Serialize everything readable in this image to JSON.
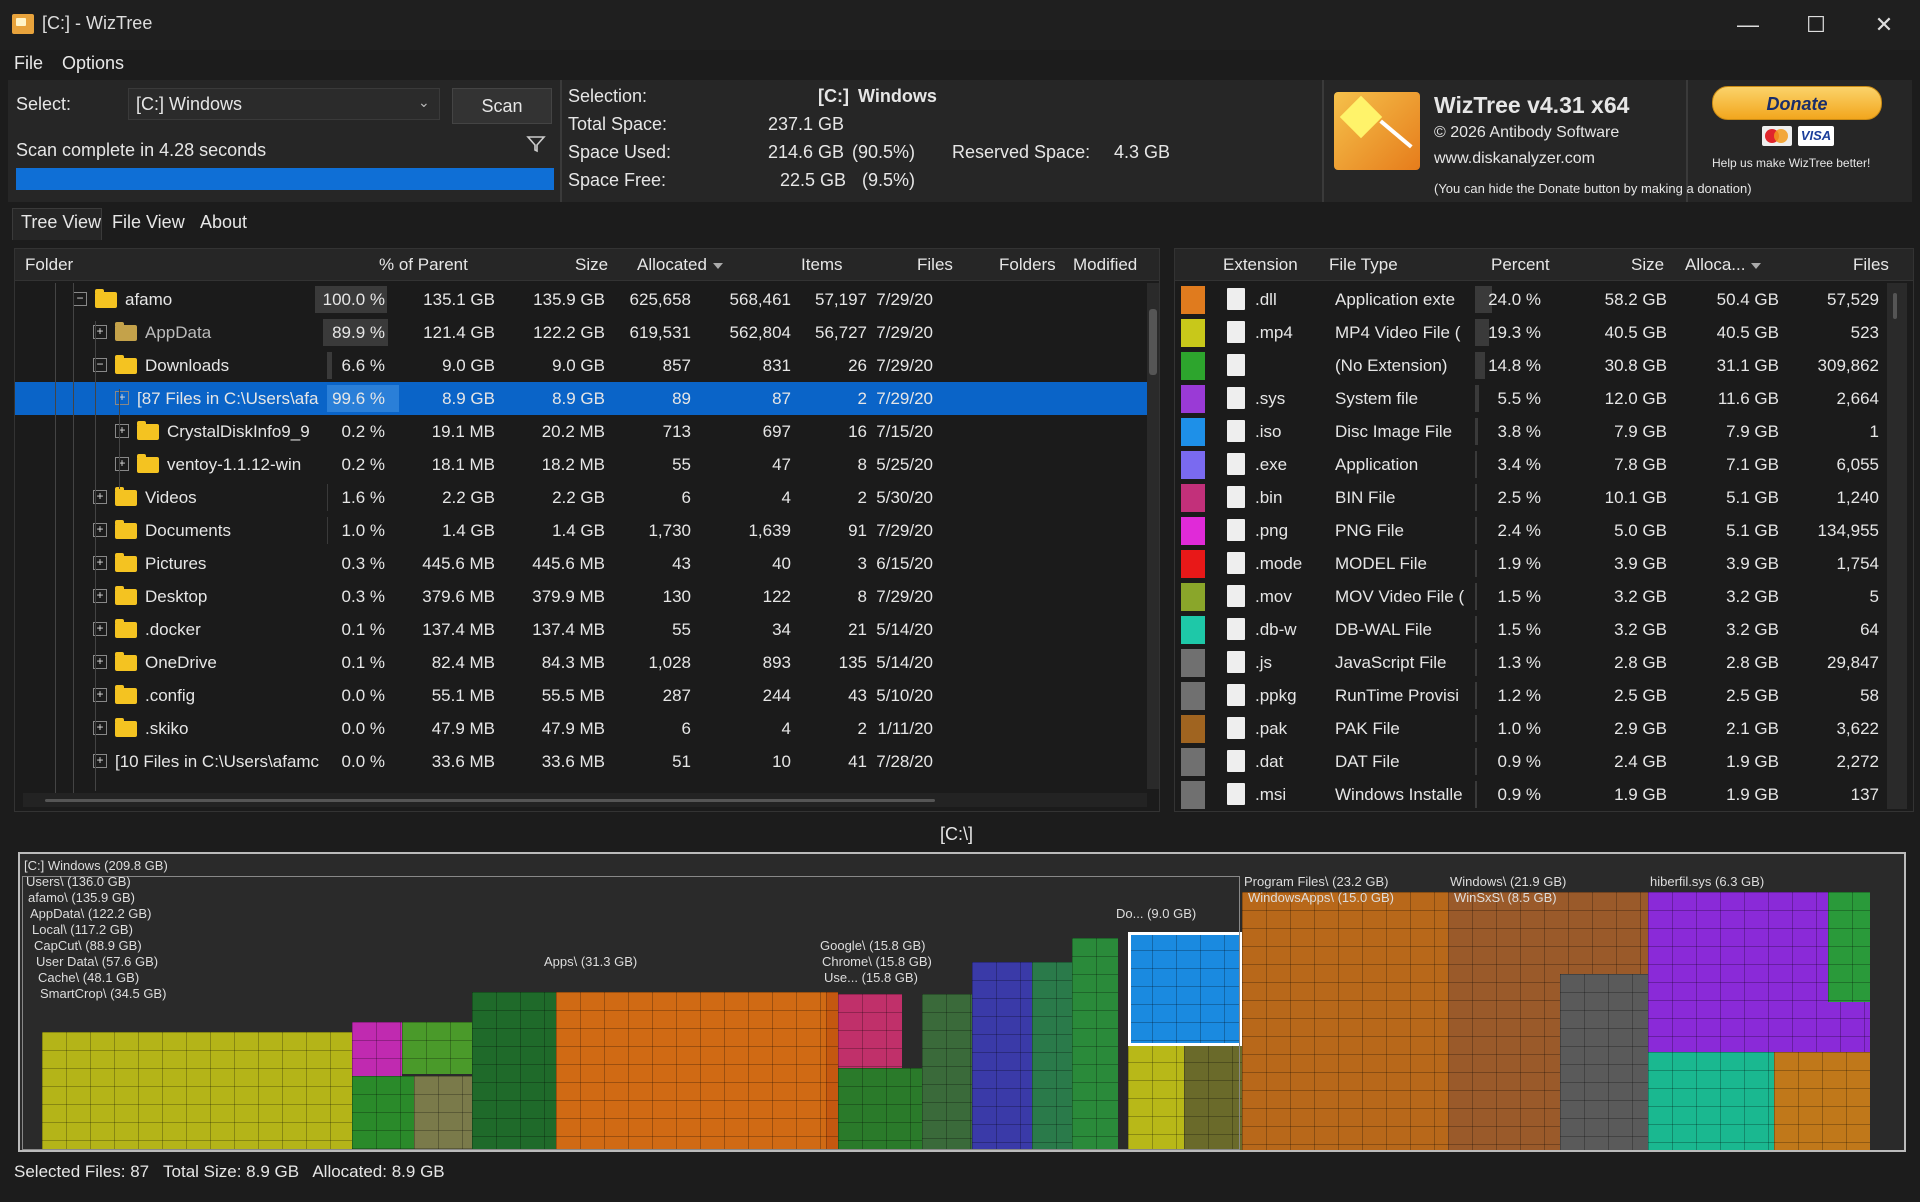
{
  "window": {
    "title": "[C:]  - WizTree",
    "controls": {
      "minimize": "—",
      "maximize": "☐",
      "close": "✕"
    }
  },
  "menu": [
    "File",
    "Options"
  ],
  "top": {
    "select_label": "Select:",
    "select_value": "[C:] Windows",
    "scan_label": "Scan",
    "status": "Scan complete in 4.28 seconds",
    "progress": 1.0,
    "selection_label": "Selection:",
    "selection_drive": "[C:]",
    "selection_name": "Windows",
    "total_space_label": "Total Space:",
    "total_space": "237.1 GB",
    "space_used_label": "Space Used:",
    "space_used": "214.6 GB",
    "space_used_pct": "(90.5%)",
    "space_free_label": "Space Free:",
    "space_free": "22.5 GB",
    "space_free_pct": "(9.5%)",
    "reserved_label": "Reserved Space:",
    "reserved": "4.3 GB"
  },
  "about": {
    "product": "WizTree v4.31 x64",
    "copyright": "© 2026 Antibody Software",
    "website": "www.diskanalyzer.com",
    "hide_note": "(You can hide the Donate button by making a donation)",
    "donate": "Donate",
    "visa": "VISA",
    "help_text": "Help us make WizTree better!"
  },
  "tabs": [
    "Tree View",
    "File View",
    "About"
  ],
  "tree": {
    "headers": {
      "folder": "Folder",
      "pct": "% of Parent",
      "size": "Size",
      "allocated": "Allocated",
      "items": "Items",
      "files": "Files",
      "folders": "Folders",
      "modified": "Modified"
    },
    "rows": [
      {
        "name": "afamo",
        "pct": "100.0 %",
        "pct_fill": 1.0,
        "size": "135.1 GB",
        "allocated": "135.9 GB",
        "items": "625,658",
        "files": "568,461",
        "folders": "57,197",
        "modified": "7/29/20",
        "toggle": "−"
      },
      {
        "name": "AppData",
        "pct": "89.9 %",
        "pct_fill": 0.899,
        "size": "121.4 GB",
        "allocated": "122.2 GB",
        "items": "619,531",
        "files": "562,804",
        "folders": "56,727",
        "modified": "7/29/20",
        "toggle": "+"
      },
      {
        "name": "Downloads",
        "pct": "6.6 %",
        "pct_fill": 0.066,
        "size": "9.0 GB",
        "allocated": "9.0 GB",
        "items": "857",
        "files": "831",
        "folders": "26",
        "modified": "7/29/20",
        "toggle": "−"
      },
      {
        "name": "[87 Files in C:\\Users\\afa",
        "pct": "99.6 %",
        "pct_fill": 0.996,
        "size": "8.9 GB",
        "allocated": "8.9 GB",
        "items": "89",
        "files": "87",
        "folders": "2",
        "modified": "7/29/20",
        "toggle": "+"
      },
      {
        "name": "CrystalDiskInfo9_9",
        "pct": "0.2 %",
        "pct_fill": 0.002,
        "size": "19.1 MB",
        "allocated": "20.2 MB",
        "items": "713",
        "files": "697",
        "folders": "16",
        "modified": "7/15/20",
        "toggle": "+"
      },
      {
        "name": "ventoy-1.1.12-win",
        "pct": "0.2 %",
        "pct_fill": 0.002,
        "size": "18.1 MB",
        "allocated": "18.2 MB",
        "items": "55",
        "files": "47",
        "folders": "8",
        "modified": "5/25/20",
        "toggle": "+"
      },
      {
        "name": "Videos",
        "pct": "1.6 %",
        "pct_fill": 0.016,
        "size": "2.2 GB",
        "allocated": "2.2 GB",
        "items": "6",
        "files": "4",
        "folders": "2",
        "modified": "5/30/20",
        "toggle": "+"
      },
      {
        "name": "Documents",
        "pct": "1.0 %",
        "pct_fill": 0.01,
        "size": "1.4 GB",
        "allocated": "1.4 GB",
        "items": "1,730",
        "files": "1,639",
        "folders": "91",
        "modified": "7/29/20",
        "toggle": "+"
      },
      {
        "name": "Pictures",
        "pct": "0.3 %",
        "pct_fill": 0.003,
        "size": "445.6 MB",
        "allocated": "445.6 MB",
        "items": "43",
        "files": "40",
        "folders": "3",
        "modified": "6/15/20",
        "toggle": "+"
      },
      {
        "name": "Desktop",
        "pct": "0.3 %",
        "pct_fill": 0.003,
        "size": "379.6 MB",
        "allocated": "379.9 MB",
        "items": "130",
        "files": "122",
        "folders": "8",
        "modified": "7/29/20",
        "toggle": "+"
      },
      {
        "name": ".docker",
        "pct": "0.1 %",
        "pct_fill": 0.001,
        "size": "137.4 MB",
        "allocated": "137.4 MB",
        "items": "55",
        "files": "34",
        "folders": "21",
        "modified": "5/14/20",
        "toggle": "+"
      },
      {
        "name": "OneDrive",
        "pct": "0.1 %",
        "pct_fill": 0.001,
        "size": "82.4 MB",
        "allocated": "84.3 MB",
        "items": "1,028",
        "files": "893",
        "folders": "135",
        "modified": "5/14/20",
        "toggle": "+"
      },
      {
        "name": ".config",
        "pct": "0.0 %",
        "pct_fill": 0.0,
        "size": "55.1 MB",
        "allocated": "55.5 MB",
        "items": "287",
        "files": "244",
        "folders": "43",
        "modified": "5/10/20",
        "toggle": "+"
      },
      {
        "name": ".skiko",
        "pct": "0.0 %",
        "pct_fill": 0.0,
        "size": "47.9 MB",
        "allocated": "47.9 MB",
        "items": "6",
        "files": "4",
        "folders": "2",
        "modified": "1/11/20",
        "toggle": "+"
      },
      {
        "name": "[10 Files in C:\\Users\\afamc",
        "pct": "0.0 %",
        "pct_fill": 0.0,
        "size": "33.6 MB",
        "allocated": "33.6 MB",
        "items": "51",
        "files": "10",
        "folders": "41",
        "modified": "7/28/20",
        "toggle": "+"
      }
    ]
  },
  "filetypes": {
    "headers": {
      "ext": "Extension",
      "type": "File Type",
      "pct": "Percent",
      "size": "Size",
      "alloc": "Alloca...",
      "files": "Files"
    },
    "rows": [
      {
        "color": "#e07b1e",
        "ext": ".dll",
        "type": "Application exte",
        "pct": "24.0 %",
        "fill": 0.24,
        "size": "58.2 GB",
        "alloc": "50.4 GB",
        "files": "57,529"
      },
      {
        "color": "#c8c81a",
        "ext": ".mp4",
        "type": "MP4 Video File (",
        "pct": "19.3 %",
        "fill": 0.193,
        "size": "40.5 GB",
        "alloc": "40.5 GB",
        "files": "523"
      },
      {
        "color": "#2da52d",
        "ext": "",
        "type": "(No Extension)",
        "pct": "14.8 %",
        "fill": 0.148,
        "size": "30.8 GB",
        "alloc": "31.1 GB",
        "files": "309,862"
      },
      {
        "color": "#9a3ad6",
        "ext": ".sys",
        "type": "System file",
        "pct": "5.5 %",
        "fill": 0.055,
        "size": "12.0 GB",
        "alloc": "11.6 GB",
        "files": "2,664"
      },
      {
        "color": "#1e90e8",
        "ext": ".iso",
        "type": "Disc Image File",
        "pct": "3.8 %",
        "fill": 0.038,
        "size": "7.9 GB",
        "alloc": "7.9 GB",
        "files": "1"
      },
      {
        "color": "#7a6af0",
        "ext": ".exe",
        "type": "Application",
        "pct": "3.4 %",
        "fill": 0.034,
        "size": "7.8 GB",
        "alloc": "7.1 GB",
        "files": "6,055"
      },
      {
        "color": "#c2307a",
        "ext": ".bin",
        "type": "BIN File",
        "pct": "2.5 %",
        "fill": 0.025,
        "size": "10.1 GB",
        "alloc": "5.1 GB",
        "files": "1,240"
      },
      {
        "color": "#e02ad8",
        "ext": ".png",
        "type": "PNG File",
        "pct": "2.4 %",
        "fill": 0.024,
        "size": "5.0 GB",
        "alloc": "5.1 GB",
        "files": "134,955"
      },
      {
        "color": "#e81818",
        "ext": ".mode",
        "type": "MODEL File",
        "pct": "1.9 %",
        "fill": 0.019,
        "size": "3.9 GB",
        "alloc": "3.9 GB",
        "files": "1,754"
      },
      {
        "color": "#8aa62a",
        "ext": ".mov",
        "type": "MOV Video File (",
        "pct": "1.5 %",
        "fill": 0.015,
        "size": "3.2 GB",
        "alloc": "3.2 GB",
        "files": "5"
      },
      {
        "color": "#1ec8a8",
        "ext": ".db-w",
        "type": "DB-WAL File",
        "pct": "1.5 %",
        "fill": 0.015,
        "size": "3.2 GB",
        "alloc": "3.2 GB",
        "files": "64"
      },
      {
        "color": "#707070",
        "ext": ".js",
        "type": "JavaScript File",
        "pct": "1.3 %",
        "fill": 0.013,
        "size": "2.8 GB",
        "alloc": "2.8 GB",
        "files": "29,847"
      },
      {
        "color": "#707070",
        "ext": ".ppkg",
        "type": "RunTime Provisi",
        "pct": "1.2 %",
        "fill": 0.012,
        "size": "2.5 GB",
        "alloc": "2.5 GB",
        "files": "58"
      },
      {
        "color": "#a06420",
        "ext": ".pak",
        "type": "PAK File",
        "pct": "1.0 %",
        "fill": 0.01,
        "size": "2.9 GB",
        "alloc": "2.1 GB",
        "files": "3,622"
      },
      {
        "color": "#707070",
        "ext": ".dat",
        "type": "DAT File",
        "pct": "0.9 %",
        "fill": 0.009,
        "size": "2.4 GB",
        "alloc": "1.9 GB",
        "files": "2,272"
      },
      {
        "color": "#707070",
        "ext": ".msi",
        "type": "Windows Installe",
        "pct": "0.9 %",
        "fill": 0.009,
        "size": "1.9 GB",
        "alloc": "1.9 GB",
        "files": "137"
      }
    ]
  },
  "treemap": {
    "path": "[C:\\]",
    "labels": {
      "root": "[C:] Windows  (209.8 GB)",
      "users": "Users\\ (136.0 GB)",
      "afamo": "afamo\\ (135.9 GB)",
      "appdata": "AppData\\ (122.2 GB)",
      "local": "Local\\ (117.2 GB)",
      "capcut": "CapCut\\ (88.9 GB)",
      "userdata": "User Data\\ (57.6 GB)",
      "cache": "Cache\\ (48.1 GB)",
      "smartcrop": "SmartCrop\\ (34.5 GB)",
      "apps": "Apps\\ (31.3 GB)",
      "google": "Google\\ (15.8 GB)",
      "chrome": "Chrome\\ (15.8 GB)",
      "use": "Use... (15.8 GB)",
      "downloads": "Do... (9.0 GB)",
      "programfiles": "Program Files\\ (23.2 GB)",
      "windowsapps": "WindowsApps\\ (15.0 GB)",
      "windows": "Windows\\ (21.9 GB)",
      "winsxs": "WinSxS\\ (8.5 GB)",
      "hiberfil": "hiberfil.sys (6.3 GB)"
    }
  },
  "status": {
    "selected_files": "Selected Files: 87",
    "total_size": "Total Size: 8.9 GB",
    "allocated": "Allocated: 8.9 GB"
  }
}
